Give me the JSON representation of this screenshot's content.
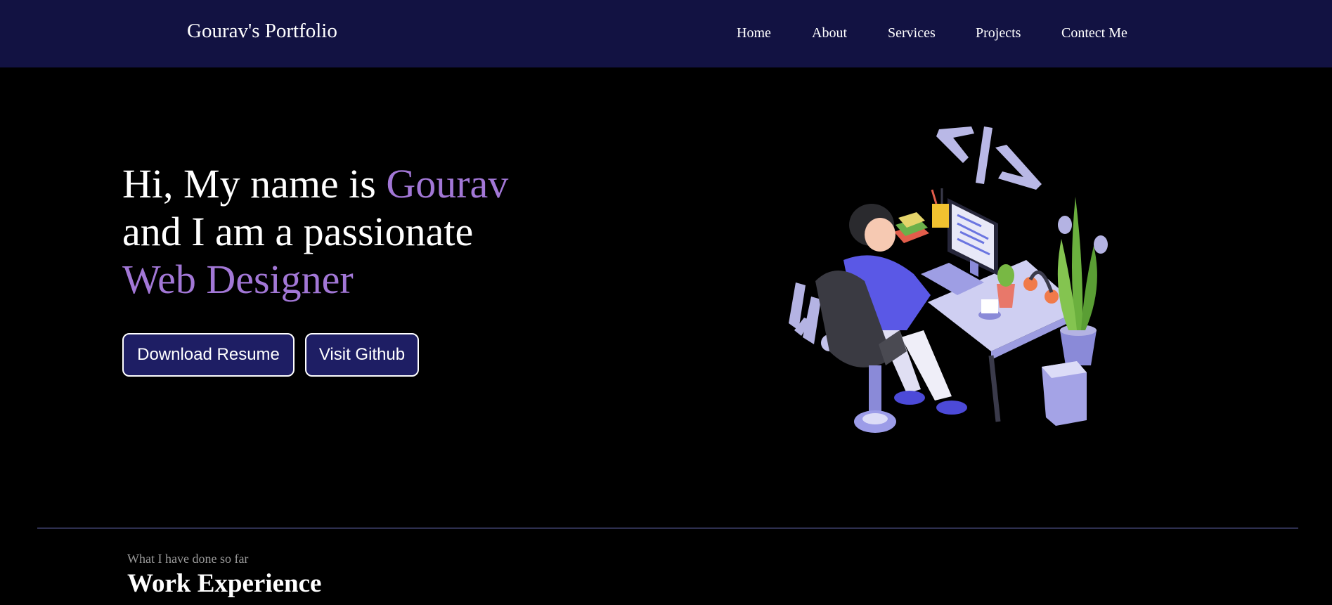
{
  "navbar": {
    "brand": "Gourav's Portfolio",
    "links": [
      "Home",
      "About",
      "Services",
      "Projects",
      "Contect Me"
    ]
  },
  "hero": {
    "line1_prefix": "Hi, My name is ",
    "line1_name": "Gourav",
    "line2": "and I am a passionate",
    "line3_role": "Web Designer",
    "buttons": {
      "resume": "Download Resume",
      "github": "Visit Github"
    },
    "illustration": "developer-at-desk-illustration"
  },
  "experience": {
    "subtitle": "What I have done so far",
    "title": "Work Experience"
  },
  "colors": {
    "navbar_bg": "#121242",
    "accent": "#a277d6",
    "button_bg": "#1e1e64",
    "divider": "#7b7fd6"
  }
}
